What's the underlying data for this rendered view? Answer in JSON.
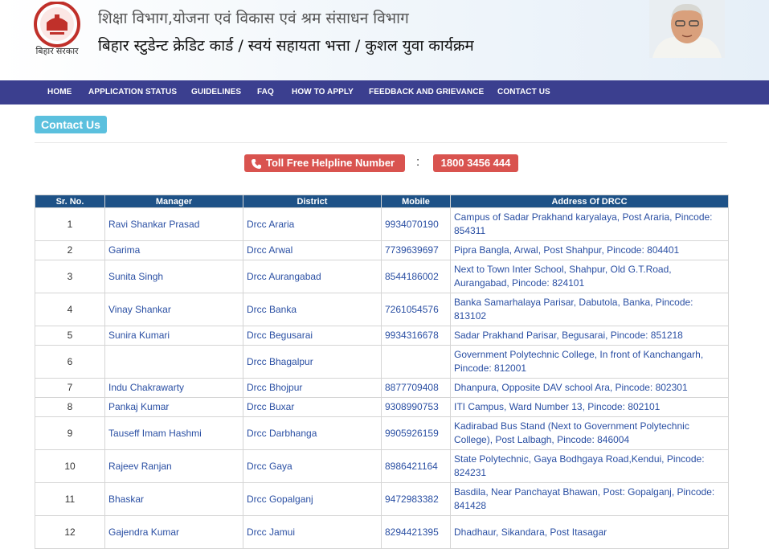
{
  "header": {
    "logo_caption": "बिहार सरकार",
    "dept_title": "शिक्षा विभाग,योजना एवं विकास एवं श्रम संसाधन विभाग",
    "scheme_title": "बिहार स्टुडेन्ट क्रेडिट कार्ड / स्वयं सहायता भत्ता / कुशल युवा कार्यक्रम"
  },
  "nav": {
    "items": [
      {
        "label": "HOME"
      },
      {
        "label": "APPLICATION STATUS"
      },
      {
        "label": "GUIDELINES"
      },
      {
        "label": "FAQ"
      },
      {
        "label": "HOW TO APPLY"
      },
      {
        "label": "FEEDBACK AND GRIEVANCE"
      },
      {
        "label": "CONTACT US"
      }
    ]
  },
  "page": {
    "badge": "Contact Us",
    "helpline_label": "Toll Free Helpline Number",
    "separator": ":",
    "helpline_number": "1800 3456 444"
  },
  "table": {
    "headers": [
      "Sr. No.",
      "Manager",
      "District",
      "Mobile",
      "Address Of DRCC"
    ],
    "rows": [
      {
        "sr": "1",
        "manager": "Ravi Shankar Prasad",
        "district": "Drcc Araria",
        "mobile": "9934070190",
        "address": "Campus of Sadar Prakhand karyalaya, Post Araria, Pincode: 854311"
      },
      {
        "sr": "2",
        "manager": "Garima",
        "district": "Drcc Arwal",
        "mobile": "7739639697",
        "address": "Pipra Bangla, Arwal, Post Shahpur, Pincode: 804401"
      },
      {
        "sr": "3",
        "manager": "Sunita Singh",
        "district": "Drcc Aurangabad",
        "mobile": "8544186002",
        "address": "Next to Town Inter School, Shahpur, Old G.T.Road, Aurangabad, Pincode: 824101"
      },
      {
        "sr": "4",
        "manager": "Vinay Shankar",
        "district": "Drcc Banka",
        "mobile": "7261054576",
        "address": "Banka Samarhalaya Parisar, Dabutola, Banka, Pincode: 813102"
      },
      {
        "sr": "5",
        "manager": "Sunira Kumari",
        "district": "Drcc Begusarai",
        "mobile": "9934316678",
        "address": "Sadar Prakhand Parisar, Begusarai, Pincode: 851218"
      },
      {
        "sr": "6",
        "manager": "",
        "district": "Drcc Bhagalpur",
        "mobile": "",
        "address": "Government Polytechnic College, In front of Kanchangarh, Pincode: 812001"
      },
      {
        "sr": "7",
        "manager": "Indu Chakrawarty",
        "district": "Drcc Bhojpur",
        "mobile": "8877709408",
        "address": "Dhanpura, Opposite DAV school Ara, Pincode: 802301"
      },
      {
        "sr": "8",
        "manager": "Pankaj Kumar",
        "district": "Drcc Buxar",
        "mobile": "9308990753",
        "address": "ITI Campus, Ward Number 13, Pincode: 802101"
      },
      {
        "sr": "9",
        "manager": "Tauseff Imam Hashmi",
        "district": "Drcc Darbhanga",
        "mobile": "9905926159",
        "address": "Kadirabad Bus Stand (Next to Government Polytechnic College), Post Lalbagh, Pincode: 846004"
      },
      {
        "sr": "10",
        "manager": "Rajeev Ranjan",
        "district": "Drcc Gaya",
        "mobile": "8986421164",
        "address": "State Polytechnic, Gaya Bodhgaya Road,Kendui, Pincode: 824231"
      },
      {
        "sr": "11",
        "manager": "Bhaskar",
        "district": "Drcc Gopalganj",
        "mobile": "9472983382",
        "address": "Basdila, Near Panchayat Bhawan, Post: Gopalganj, Pincode: 841428"
      },
      {
        "sr": "12",
        "manager": "Gajendra Kumar",
        "district": "Drcc Jamui",
        "mobile": "8294421395",
        "address": "Dhadhaur, Sikandara, Post Itasagar"
      }
    ]
  }
}
